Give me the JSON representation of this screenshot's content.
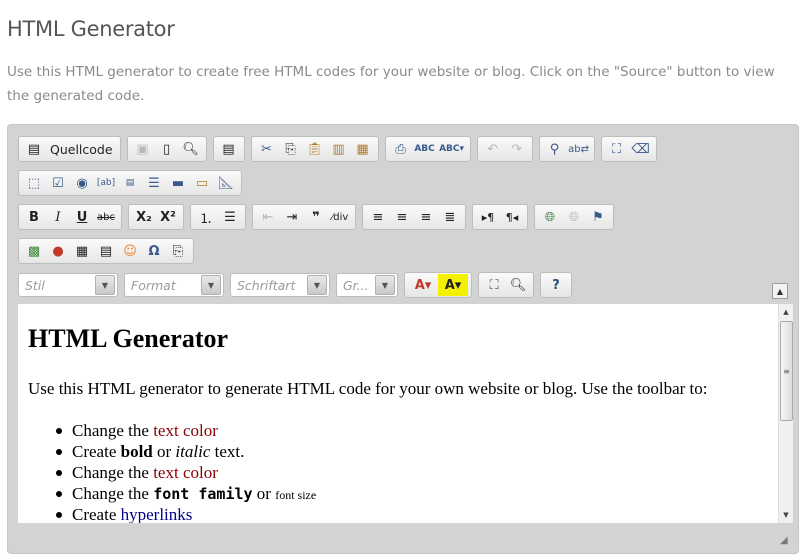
{
  "page": {
    "title": "HTML Generator",
    "intro": "Use this HTML generator to create free HTML codes for your website or blog. Click on the \"Source\" button to view the generated code."
  },
  "toolbar": {
    "source_label": "Quellcode",
    "combos": {
      "style": "Stil",
      "format": "Format",
      "font": "Schriftart",
      "size": "Gr..."
    },
    "format_glyphs": {
      "bold": "B",
      "italic": "I",
      "underline": "U",
      "strike": "abc",
      "subscript": "X₂",
      "superscript": "X²"
    },
    "icons": {
      "save": "save-icon",
      "new_page": "new-page-icon",
      "preview": "preview-icon",
      "templates": "templates-icon",
      "cut": "cut-icon",
      "copy": "copy-icon",
      "paste": "paste-icon",
      "paste_text": "paste-text-icon",
      "paste_word": "paste-word-icon",
      "print": "print-icon",
      "spellcheck": "spellcheck-icon",
      "scayt": "scayt-icon",
      "undo": "undo-icon",
      "redo": "redo-icon",
      "find": "find-icon",
      "replace": "replace-icon",
      "select_all": "select-all-icon",
      "remove_format": "eraser-icon"
    }
  },
  "content": {
    "heading": "HTML Generator",
    "paragraph": "Use this HTML generator to generate HTML code for your own website or blog. Use the toolbar to:",
    "list": [
      {
        "pre": "Change the ",
        "hl": "text color",
        "post": ""
      },
      {
        "pre": "Create ",
        "b": "bold",
        "mid": " or ",
        "i": "italic",
        "post": " text."
      },
      {
        "pre": "Change the ",
        "hl": "text color",
        "post": ""
      },
      {
        "pre": "Change the ",
        "mono": "font family",
        "mid": " or ",
        "small": "font size"
      },
      {
        "pre": "Create ",
        "link": "hyperlinks"
      }
    ]
  }
}
